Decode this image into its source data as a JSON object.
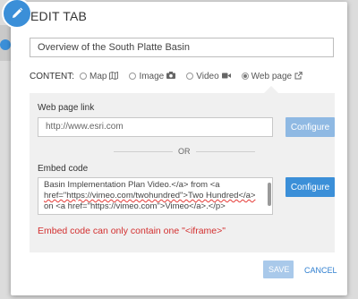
{
  "dialog": {
    "title": "EDIT TAB",
    "tab_title_value": "Overview of the South Platte Basin"
  },
  "content": {
    "label": "CONTENT:",
    "options": [
      {
        "label": "Map",
        "icon": "map-icon",
        "selected": false
      },
      {
        "label": "Image",
        "icon": "camera-icon",
        "selected": false
      },
      {
        "label": "Video",
        "icon": "video-camera-icon",
        "selected": false
      },
      {
        "label": "Web page",
        "icon": "external-link-icon",
        "selected": true
      }
    ]
  },
  "webpage": {
    "link_label": "Web page link",
    "link_placeholder": "http://www.esri.com",
    "configure_label": "Configure",
    "or_label": "OR",
    "embed_label": "Embed code",
    "embed_lines": [
      "Basin Implementation Plan Video.</a> from <a",
      "href=\"https://vimeo.com/twohundred\">Two Hundred</a>",
      "on <a href=\"https://vimeo.com\">Vimeo</a>.</p>"
    ],
    "embed_configure_label": "Configure",
    "error_text": "Embed code can only contain one \"<iframe>\""
  },
  "footer": {
    "save_label": "SAVE",
    "cancel_label": "CANCEL"
  },
  "colors": {
    "accent": "#3b8fd8",
    "error": "#d32f2f",
    "disabled_button": "#a9c9ea"
  }
}
